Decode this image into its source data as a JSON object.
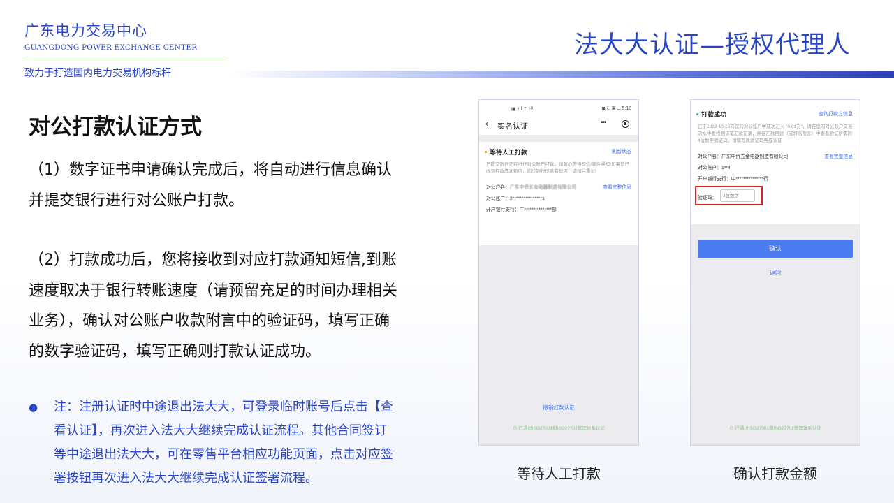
{
  "header": {
    "org_name": "广东电力交易中心",
    "org_name_en": "GUANGDONG POWER EXCHANGE CENTER",
    "slogan": "致力于打造国内电力交易机构标杆",
    "page_title": "法大大认证—授权代理人"
  },
  "content": {
    "section_heading": "对公打款认证方式",
    "para1": "（1）数字证书申请确认完成后，将自动进行信息确认并提交银行进行对公账户打款。",
    "para2": "（2）打款成功后，您将接收到对应打款通知短信,到账速度取决于银行转账速度（请预留充足的时间办理相关业务），确认对公账户收款附言中的验证码，填写正确的数字验证码，填写正确则打款认证成功。",
    "note_bullet": "●",
    "note": "注：注册认证时中途退出法大大，可登录临时账号后点击【查看认证】，再次进入法大大继续完成认证流程。其他合同签订等中途退出法大大，可在零售平台相应功能页面，点击对应签署按钮再次进入法大大继续完成认证签署流程。"
  },
  "colors": {
    "brand_blue": "#2b46c4",
    "link_blue": "#3d6ce8",
    "pending_dot": "#f5a623",
    "success_dot": "#3cb371",
    "highlight_red": "#e02020"
  },
  "phone1": {
    "status_left": "▣ ⁴ıl ⇡ ⁵ᴳ",
    "status_right": "◙ ⏾ ▣ ▭ 5:18",
    "back_icon": "‹",
    "nav_title": "实名认证",
    "more_icon": "•••",
    "card_title": "等待人工打款",
    "card_link": "刷新状态",
    "card_desc": "已提交银行正在进行对公账户打款。请耐心等待短信/邮件通知!如果您已收到打款成功短信，同步银行信息有延迟，请稍后重试!",
    "row_name_label": "对公户名：",
    "row_name_value": "广东中侨五金电器制造有限公司",
    "row_name_link": "查看完整信息",
    "row_account": "对公账户：2****************1",
    "row_bank": "开户银行支行：广***************部",
    "bottom_link": "撤销打款认证",
    "footer": "⊘ 已通过ISO27001和ISO27701管理体系认证",
    "caption": "等待人工打款"
  },
  "phone2": {
    "card_title": "打款成功",
    "card_link": "查询打款方信息",
    "card_desc": "已于2022-10-26向您的对公账户中成功汇入 \"0.01元\"，请在您的对公账户交易流水中查找到该笔汇款记录，并在汇款用途（或转账附言）中查看验证所需的4位数字验证码，请填写此验证码完成认证",
    "row_name": "对公户名：广东中侨五金电器制造有限公司",
    "row_name_link": "查看完整信息",
    "row_account": "对公账户：1**4",
    "row_bank": "开户银行支行：中***************行",
    "verify_label": "验证码：",
    "verify_placeholder": "4位数字",
    "confirm_label": "确认",
    "back_label": "返回",
    "footer": "⊘ 已通过ISO27001和ISO27701管理体系认证",
    "caption": "确认打款金额"
  }
}
